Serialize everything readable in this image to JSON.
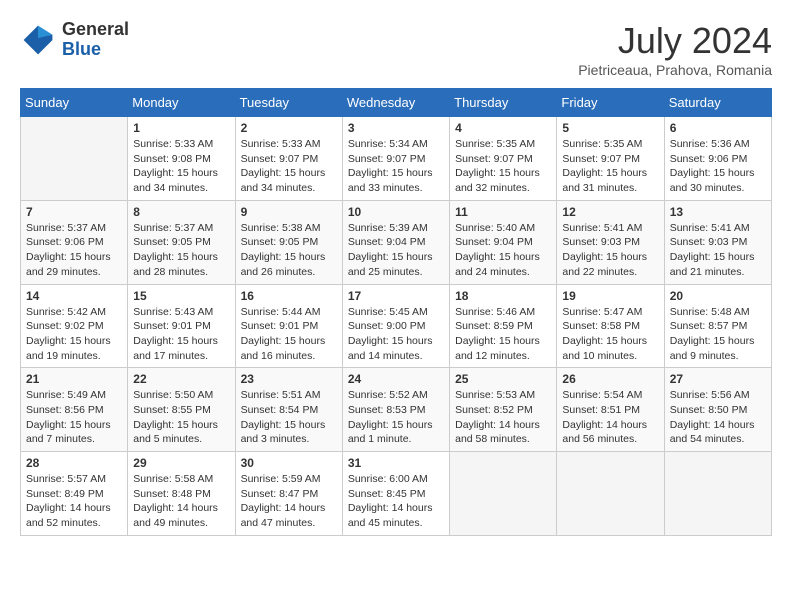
{
  "header": {
    "logo_line1": "General",
    "logo_line2": "Blue",
    "title": "July 2024",
    "subtitle": "Pietriceaua, Prahova, Romania"
  },
  "calendar": {
    "days_of_week": [
      "Sunday",
      "Monday",
      "Tuesday",
      "Wednesday",
      "Thursday",
      "Friday",
      "Saturday"
    ],
    "weeks": [
      [
        {
          "day": "",
          "info": ""
        },
        {
          "day": "1",
          "info": "Sunrise: 5:33 AM\nSunset: 9:08 PM\nDaylight: 15 hours\nand 34 minutes."
        },
        {
          "day": "2",
          "info": "Sunrise: 5:33 AM\nSunset: 9:07 PM\nDaylight: 15 hours\nand 34 minutes."
        },
        {
          "day": "3",
          "info": "Sunrise: 5:34 AM\nSunset: 9:07 PM\nDaylight: 15 hours\nand 33 minutes."
        },
        {
          "day": "4",
          "info": "Sunrise: 5:35 AM\nSunset: 9:07 PM\nDaylight: 15 hours\nand 32 minutes."
        },
        {
          "day": "5",
          "info": "Sunrise: 5:35 AM\nSunset: 9:07 PM\nDaylight: 15 hours\nand 31 minutes."
        },
        {
          "day": "6",
          "info": "Sunrise: 5:36 AM\nSunset: 9:06 PM\nDaylight: 15 hours\nand 30 minutes."
        }
      ],
      [
        {
          "day": "7",
          "info": "Sunrise: 5:37 AM\nSunset: 9:06 PM\nDaylight: 15 hours\nand 29 minutes."
        },
        {
          "day": "8",
          "info": "Sunrise: 5:37 AM\nSunset: 9:05 PM\nDaylight: 15 hours\nand 28 minutes."
        },
        {
          "day": "9",
          "info": "Sunrise: 5:38 AM\nSunset: 9:05 PM\nDaylight: 15 hours\nand 26 minutes."
        },
        {
          "day": "10",
          "info": "Sunrise: 5:39 AM\nSunset: 9:04 PM\nDaylight: 15 hours\nand 25 minutes."
        },
        {
          "day": "11",
          "info": "Sunrise: 5:40 AM\nSunset: 9:04 PM\nDaylight: 15 hours\nand 24 minutes."
        },
        {
          "day": "12",
          "info": "Sunrise: 5:41 AM\nSunset: 9:03 PM\nDaylight: 15 hours\nand 22 minutes."
        },
        {
          "day": "13",
          "info": "Sunrise: 5:41 AM\nSunset: 9:03 PM\nDaylight: 15 hours\nand 21 minutes."
        }
      ],
      [
        {
          "day": "14",
          "info": "Sunrise: 5:42 AM\nSunset: 9:02 PM\nDaylight: 15 hours\nand 19 minutes."
        },
        {
          "day": "15",
          "info": "Sunrise: 5:43 AM\nSunset: 9:01 PM\nDaylight: 15 hours\nand 17 minutes."
        },
        {
          "day": "16",
          "info": "Sunrise: 5:44 AM\nSunset: 9:01 PM\nDaylight: 15 hours\nand 16 minutes."
        },
        {
          "day": "17",
          "info": "Sunrise: 5:45 AM\nSunset: 9:00 PM\nDaylight: 15 hours\nand 14 minutes."
        },
        {
          "day": "18",
          "info": "Sunrise: 5:46 AM\nSunset: 8:59 PM\nDaylight: 15 hours\nand 12 minutes."
        },
        {
          "day": "19",
          "info": "Sunrise: 5:47 AM\nSunset: 8:58 PM\nDaylight: 15 hours\nand 10 minutes."
        },
        {
          "day": "20",
          "info": "Sunrise: 5:48 AM\nSunset: 8:57 PM\nDaylight: 15 hours\nand 9 minutes."
        }
      ],
      [
        {
          "day": "21",
          "info": "Sunrise: 5:49 AM\nSunset: 8:56 PM\nDaylight: 15 hours\nand 7 minutes."
        },
        {
          "day": "22",
          "info": "Sunrise: 5:50 AM\nSunset: 8:55 PM\nDaylight: 15 hours\nand 5 minutes."
        },
        {
          "day": "23",
          "info": "Sunrise: 5:51 AM\nSunset: 8:54 PM\nDaylight: 15 hours\nand 3 minutes."
        },
        {
          "day": "24",
          "info": "Sunrise: 5:52 AM\nSunset: 8:53 PM\nDaylight: 15 hours\nand 1 minute."
        },
        {
          "day": "25",
          "info": "Sunrise: 5:53 AM\nSunset: 8:52 PM\nDaylight: 14 hours\nand 58 minutes."
        },
        {
          "day": "26",
          "info": "Sunrise: 5:54 AM\nSunset: 8:51 PM\nDaylight: 14 hours\nand 56 minutes."
        },
        {
          "day": "27",
          "info": "Sunrise: 5:56 AM\nSunset: 8:50 PM\nDaylight: 14 hours\nand 54 minutes."
        }
      ],
      [
        {
          "day": "28",
          "info": "Sunrise: 5:57 AM\nSunset: 8:49 PM\nDaylight: 14 hours\nand 52 minutes."
        },
        {
          "day": "29",
          "info": "Sunrise: 5:58 AM\nSunset: 8:48 PM\nDaylight: 14 hours\nand 49 minutes."
        },
        {
          "day": "30",
          "info": "Sunrise: 5:59 AM\nSunset: 8:47 PM\nDaylight: 14 hours\nand 47 minutes."
        },
        {
          "day": "31",
          "info": "Sunrise: 6:00 AM\nSunset: 8:45 PM\nDaylight: 14 hours\nand 45 minutes."
        },
        {
          "day": "",
          "info": ""
        },
        {
          "day": "",
          "info": ""
        },
        {
          "day": "",
          "info": ""
        }
      ]
    ]
  }
}
